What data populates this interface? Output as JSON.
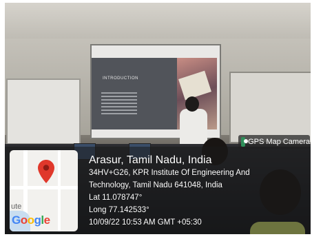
{
  "photo": {
    "slide_title": "INTRODUCTION"
  },
  "badge": {
    "icon": "gps-camera-icon",
    "label": "GPS Map Camera"
  },
  "map": {
    "pin_icon": "map-pin-icon",
    "pin_color": "#e0382b",
    "place_fragment": "ute",
    "logo": "Google"
  },
  "location": {
    "title": "Arasur, Tamil Nadu, India",
    "address_line1": "34HV+G26, KPR Institute Of Engineering And",
    "address_line2": "Technology, Tamil Nadu 641048, India",
    "lat": "Lat 11.078747°",
    "long": "Long 77.142533°",
    "datetime": "10/09/22 10:53 AM GMT +05:30"
  }
}
